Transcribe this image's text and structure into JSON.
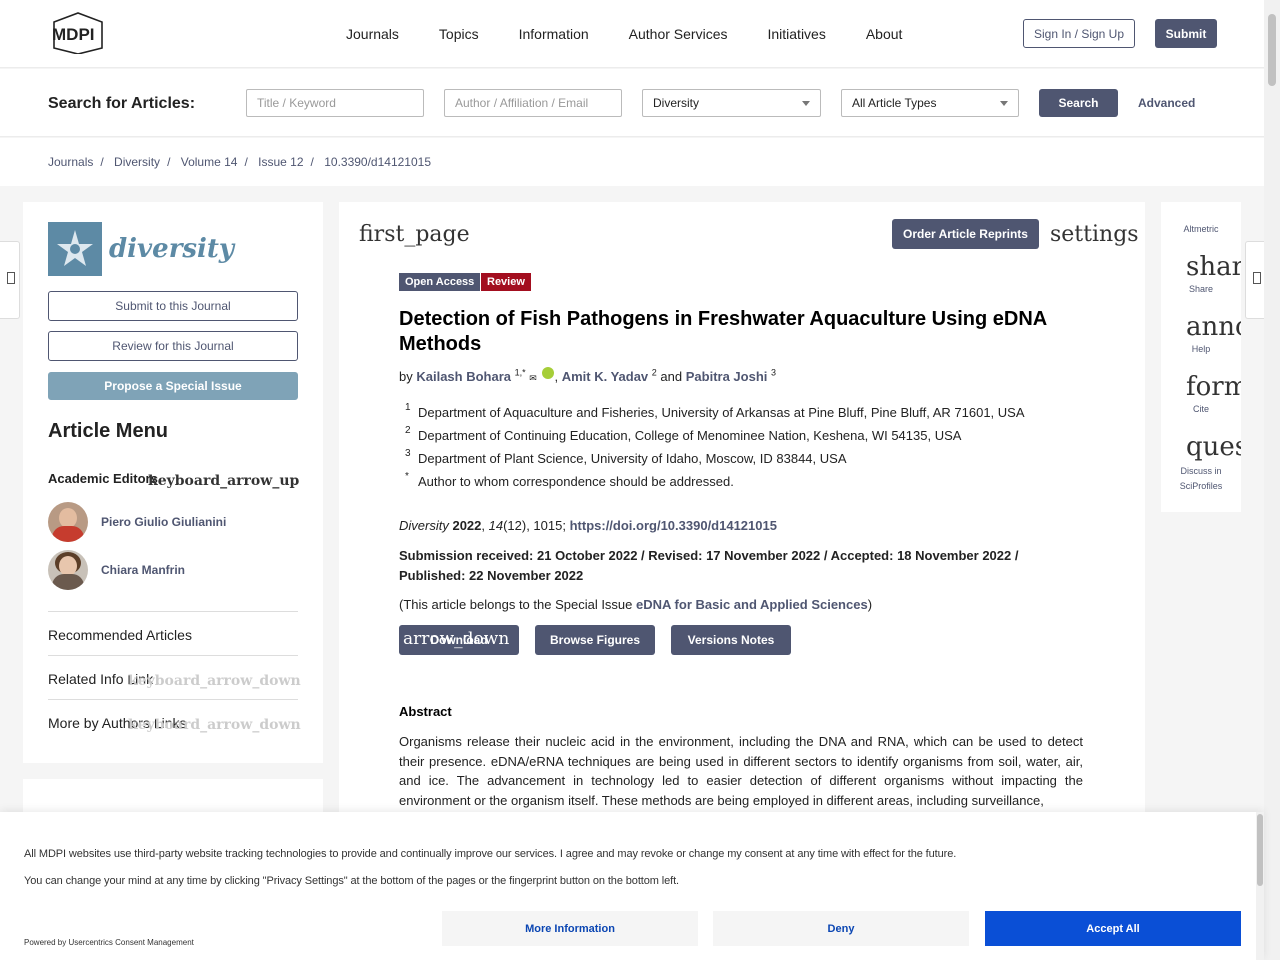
{
  "header": {
    "logo_text": "MDPI",
    "nav": [
      "Journals",
      "Topics",
      "Information",
      "Author Services",
      "Initiatives",
      "About"
    ],
    "signin_label": "Sign In / Sign Up",
    "submit_label": "Submit"
  },
  "search": {
    "label": "Search for Articles:",
    "title_placeholder": "Title / Keyword",
    "author_placeholder": "Author / Affiliation / Email",
    "journal_value": "Diversity",
    "type_value": "All Article Types",
    "search_label": "Search",
    "advanced_label": "Advanced"
  },
  "breadcrumb": {
    "items": [
      "Journals",
      "Diversity",
      "Volume 14",
      "Issue 12",
      "10.3390/d14121015"
    ],
    "separator": "/"
  },
  "sidebar": {
    "journal_name": "diversity",
    "submit_label": "Submit to this Journal",
    "review_label": "Review for this Journal",
    "propose_label": "Propose a Special Issue",
    "article_menu": "Article Menu",
    "academic_editors_label": "Academic Editors",
    "arrow_up": "keyboard_arrow_up",
    "arrow_down": "keyboard_arrow_down",
    "editors": [
      "Piero Giulio Giulianini",
      "Chiara Manfrin"
    ],
    "menu": [
      "Recommended Articles",
      "Related Info Link",
      "More by Authors Links"
    ]
  },
  "article": {
    "first_page_icon": "first_page",
    "reprints_label": "Order Article Reprints",
    "settings_icon": "settings",
    "tags": [
      "Open Access",
      "Review"
    ],
    "title": "Detection of Fish Pathogens in Freshwater Aquaculture Using eDNA Methods",
    "by": "by",
    "authors": [
      {
        "name": "Kailash Bohara",
        "sup": "1,*"
      },
      {
        "name": "Amit K. Yadav",
        "sup": "2"
      },
      {
        "name": "Pabitra Joshi",
        "sup": "3"
      }
    ],
    "and_word": "and",
    "email_glyph": "✉",
    "affiliations": [
      {
        "sup": "1",
        "text": "Department of Aquaculture and Fisheries, University of Arkansas at Pine Bluff, Pine Bluff, AR 71601, USA"
      },
      {
        "sup": "2",
        "text": "Department of Continuing Education, College of Menominee Nation, Keshena, WI 54135, USA"
      },
      {
        "sup": "3",
        "text": "Department of Plant Science, University of Idaho, Moscow, ID 83844, USA"
      },
      {
        "sup": "*",
        "text": "Author to whom correspondence should be addressed."
      }
    ],
    "citation": {
      "journal": "Diversity",
      "year": "2022",
      "volume": "14",
      "rest": "(12), 1015;",
      "doi": "https://doi.org/10.3390/d14121015"
    },
    "dates": "Submission received: 21 October 2022 / Revised: 17 November 2022 / Accepted: 18 November 2022 / Published: 22 November 2022",
    "special_prefix": "(This article belongs to the Special Issue",
    "special_link": "eDNA for Basic and Applied Sciences",
    "special_suffix": ")",
    "download_label": "Download",
    "download_icon": "arrow_down",
    "figures_label": "Browse Figures",
    "versions_label": "Versions Notes",
    "abstract_heading": "Abstract",
    "abstract_text": "Organisms release their nucleic acid in the environment, including the DNA and RNA, which can be used to detect their presence. eDNA/eRNA techniques are being used in different sectors to identify organisms from soil, water, air, and ice. The advancement in technology led to easier detection of different organisms without impacting the environment or the organism itself. These methods are being employed in different areas, including surveillance,"
  },
  "right_sidebar": {
    "altmetric": "Altmetric",
    "items": [
      {
        "icon": "share",
        "label": "Share"
      },
      {
        "icon": "announcement",
        "label": "Help"
      },
      {
        "icon": "format_quote",
        "label": "Cite"
      },
      {
        "icon": "question_answer",
        "label": "Discuss in SciProfiles"
      }
    ]
  },
  "consent": {
    "line1": "All MDPI websites use third-party website tracking technologies to provide and continually improve our services. I agree and may revoke or change my consent at any time with effect for the future.",
    "line2": "You can change your mind at any time by clicking \"Privacy Settings\" at the bottom of the pages or the fingerprint button on the bottom left.",
    "powered": "Powered by Usercentrics Consent Management",
    "more_label": "More Information",
    "deny_label": "Deny",
    "accept_label": "Accept All"
  },
  "colors": {
    "primary": "#4f5671",
    "review_tag": "#a30e1f",
    "journal": "#5d8aa5",
    "accept": "#0a4fd6"
  }
}
